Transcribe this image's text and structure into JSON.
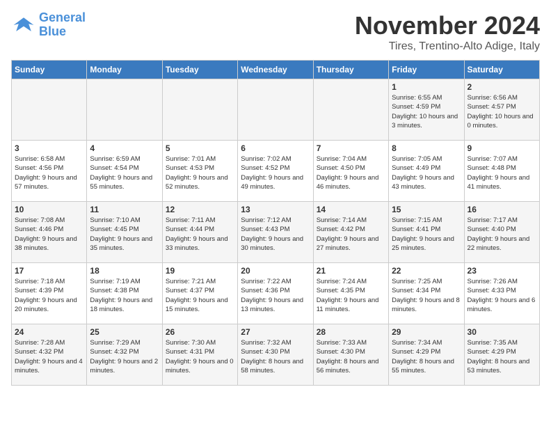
{
  "logo": {
    "line1": "General",
    "line2": "Blue"
  },
  "title": "November 2024",
  "location": "Tires, Trentino-Alto Adige, Italy",
  "weekdays": [
    "Sunday",
    "Monday",
    "Tuesday",
    "Wednesday",
    "Thursday",
    "Friday",
    "Saturday"
  ],
  "weeks": [
    [
      {
        "day": "",
        "sunrise": "",
        "sunset": "",
        "daylight": ""
      },
      {
        "day": "",
        "sunrise": "",
        "sunset": "",
        "daylight": ""
      },
      {
        "day": "",
        "sunrise": "",
        "sunset": "",
        "daylight": ""
      },
      {
        "day": "",
        "sunrise": "",
        "sunset": "",
        "daylight": ""
      },
      {
        "day": "",
        "sunrise": "",
        "sunset": "",
        "daylight": ""
      },
      {
        "day": "1",
        "sunrise": "Sunrise: 6:55 AM",
        "sunset": "Sunset: 4:59 PM",
        "daylight": "Daylight: 10 hours and 3 minutes."
      },
      {
        "day": "2",
        "sunrise": "Sunrise: 6:56 AM",
        "sunset": "Sunset: 4:57 PM",
        "daylight": "Daylight: 10 hours and 0 minutes."
      }
    ],
    [
      {
        "day": "3",
        "sunrise": "Sunrise: 6:58 AM",
        "sunset": "Sunset: 4:56 PM",
        "daylight": "Daylight: 9 hours and 57 minutes."
      },
      {
        "day": "4",
        "sunrise": "Sunrise: 6:59 AM",
        "sunset": "Sunset: 4:54 PM",
        "daylight": "Daylight: 9 hours and 55 minutes."
      },
      {
        "day": "5",
        "sunrise": "Sunrise: 7:01 AM",
        "sunset": "Sunset: 4:53 PM",
        "daylight": "Daylight: 9 hours and 52 minutes."
      },
      {
        "day": "6",
        "sunrise": "Sunrise: 7:02 AM",
        "sunset": "Sunset: 4:52 PM",
        "daylight": "Daylight: 9 hours and 49 minutes."
      },
      {
        "day": "7",
        "sunrise": "Sunrise: 7:04 AM",
        "sunset": "Sunset: 4:50 PM",
        "daylight": "Daylight: 9 hours and 46 minutes."
      },
      {
        "day": "8",
        "sunrise": "Sunrise: 7:05 AM",
        "sunset": "Sunset: 4:49 PM",
        "daylight": "Daylight: 9 hours and 43 minutes."
      },
      {
        "day": "9",
        "sunrise": "Sunrise: 7:07 AM",
        "sunset": "Sunset: 4:48 PM",
        "daylight": "Daylight: 9 hours and 41 minutes."
      }
    ],
    [
      {
        "day": "10",
        "sunrise": "Sunrise: 7:08 AM",
        "sunset": "Sunset: 4:46 PM",
        "daylight": "Daylight: 9 hours and 38 minutes."
      },
      {
        "day": "11",
        "sunrise": "Sunrise: 7:10 AM",
        "sunset": "Sunset: 4:45 PM",
        "daylight": "Daylight: 9 hours and 35 minutes."
      },
      {
        "day": "12",
        "sunrise": "Sunrise: 7:11 AM",
        "sunset": "Sunset: 4:44 PM",
        "daylight": "Daylight: 9 hours and 33 minutes."
      },
      {
        "day": "13",
        "sunrise": "Sunrise: 7:12 AM",
        "sunset": "Sunset: 4:43 PM",
        "daylight": "Daylight: 9 hours and 30 minutes."
      },
      {
        "day": "14",
        "sunrise": "Sunrise: 7:14 AM",
        "sunset": "Sunset: 4:42 PM",
        "daylight": "Daylight: 9 hours and 27 minutes."
      },
      {
        "day": "15",
        "sunrise": "Sunrise: 7:15 AM",
        "sunset": "Sunset: 4:41 PM",
        "daylight": "Daylight: 9 hours and 25 minutes."
      },
      {
        "day": "16",
        "sunrise": "Sunrise: 7:17 AM",
        "sunset": "Sunset: 4:40 PM",
        "daylight": "Daylight: 9 hours and 22 minutes."
      }
    ],
    [
      {
        "day": "17",
        "sunrise": "Sunrise: 7:18 AM",
        "sunset": "Sunset: 4:39 PM",
        "daylight": "Daylight: 9 hours and 20 minutes."
      },
      {
        "day": "18",
        "sunrise": "Sunrise: 7:19 AM",
        "sunset": "Sunset: 4:38 PM",
        "daylight": "Daylight: 9 hours and 18 minutes."
      },
      {
        "day": "19",
        "sunrise": "Sunrise: 7:21 AM",
        "sunset": "Sunset: 4:37 PM",
        "daylight": "Daylight: 9 hours and 15 minutes."
      },
      {
        "day": "20",
        "sunrise": "Sunrise: 7:22 AM",
        "sunset": "Sunset: 4:36 PM",
        "daylight": "Daylight: 9 hours and 13 minutes."
      },
      {
        "day": "21",
        "sunrise": "Sunrise: 7:24 AM",
        "sunset": "Sunset: 4:35 PM",
        "daylight": "Daylight: 9 hours and 11 minutes."
      },
      {
        "day": "22",
        "sunrise": "Sunrise: 7:25 AM",
        "sunset": "Sunset: 4:34 PM",
        "daylight": "Daylight: 9 hours and 8 minutes."
      },
      {
        "day": "23",
        "sunrise": "Sunrise: 7:26 AM",
        "sunset": "Sunset: 4:33 PM",
        "daylight": "Daylight: 9 hours and 6 minutes."
      }
    ],
    [
      {
        "day": "24",
        "sunrise": "Sunrise: 7:28 AM",
        "sunset": "Sunset: 4:32 PM",
        "daylight": "Daylight: 9 hours and 4 minutes."
      },
      {
        "day": "25",
        "sunrise": "Sunrise: 7:29 AM",
        "sunset": "Sunset: 4:32 PM",
        "daylight": "Daylight: 9 hours and 2 minutes."
      },
      {
        "day": "26",
        "sunrise": "Sunrise: 7:30 AM",
        "sunset": "Sunset: 4:31 PM",
        "daylight": "Daylight: 9 hours and 0 minutes."
      },
      {
        "day": "27",
        "sunrise": "Sunrise: 7:32 AM",
        "sunset": "Sunset: 4:30 PM",
        "daylight": "Daylight: 8 hours and 58 minutes."
      },
      {
        "day": "28",
        "sunrise": "Sunrise: 7:33 AM",
        "sunset": "Sunset: 4:30 PM",
        "daylight": "Daylight: 8 hours and 56 minutes."
      },
      {
        "day": "29",
        "sunrise": "Sunrise: 7:34 AM",
        "sunset": "Sunset: 4:29 PM",
        "daylight": "Daylight: 8 hours and 55 minutes."
      },
      {
        "day": "30",
        "sunrise": "Sunrise: 7:35 AM",
        "sunset": "Sunset: 4:29 PM",
        "daylight": "Daylight: 8 hours and 53 minutes."
      }
    ]
  ]
}
